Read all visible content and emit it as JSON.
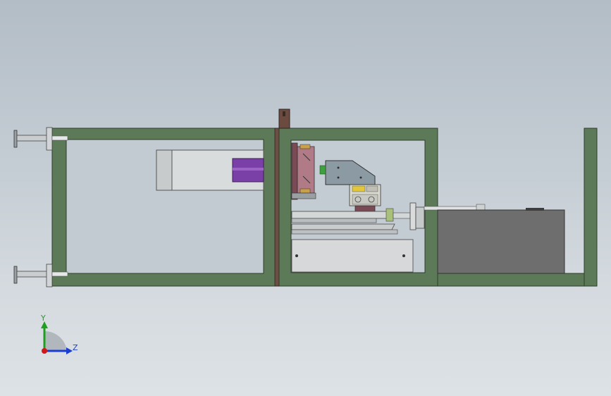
{
  "view": {
    "background_top": "#b3bdc6",
    "background_bottom": "#dde2e6"
  },
  "colors": {
    "frame_green": "#5d7a58",
    "frame_edge": "#2f3d2c",
    "purple": "#7b3fa8",
    "gray_block": "#6e6e6e",
    "light_gray": "#cfd3d4"
  },
  "triad": {
    "y_label": "Y",
    "z_label": "Z",
    "y_color": "#1ea01e",
    "z_color": "#1a3fd0",
    "x_color": "#d01818"
  }
}
